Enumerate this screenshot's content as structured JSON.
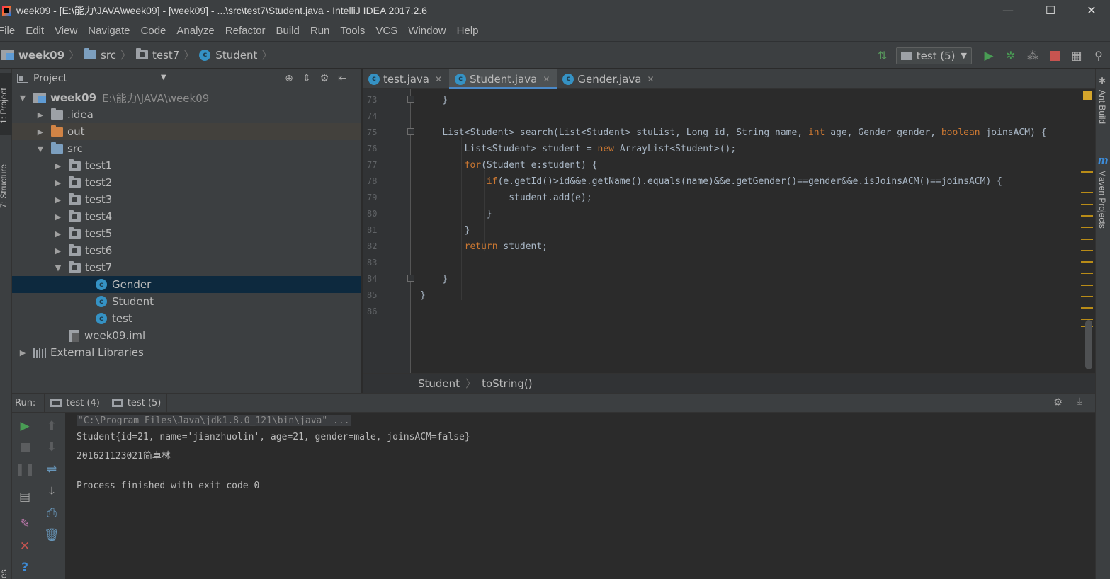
{
  "window": {
    "title": "week09 - [E:\\能力\\JAVA\\week09] - [week09] - ...\\src\\test7\\Student.java - IntelliJ IDEA 2017.2.6",
    "minimize": "—",
    "maximize": "☐",
    "close": "✕"
  },
  "menu": [
    {
      "rest": "ile",
      "mn": "F"
    },
    {
      "rest": "dit",
      "mn": "E"
    },
    {
      "rest": "iew",
      "mn": "V"
    },
    {
      "rest": "avigate",
      "mn": "N"
    },
    {
      "rest": "ode",
      "mn": "C"
    },
    {
      "rest": "nalyze",
      "mn": "A"
    },
    {
      "rest": "efactor",
      "mn": "R"
    },
    {
      "rest": "uild",
      "mn": "B"
    },
    {
      "rest": "un",
      "mn": "R"
    },
    {
      "rest": "ools",
      "mn": "T"
    },
    {
      "rest": "CS",
      "mn": "V"
    },
    {
      "rest": "indow",
      "mn": "W"
    },
    {
      "rest": "elp",
      "mn": "H"
    }
  ],
  "navbar": {
    "crumbs": [
      "week09",
      "src",
      "test7",
      "Student"
    ],
    "run_config": "test (5)"
  },
  "left_stripe": {
    "project_tab": "1: Project",
    "structure_tab": "7: Structure",
    "bottom_tab": "es"
  },
  "right_stripe": {
    "ant": "Ant Build",
    "maven": "Maven Projects"
  },
  "project_panel": {
    "title": "Project",
    "tree": [
      {
        "label": "week09",
        "hint": "E:\\能力\\JAVA\\week09",
        "icon": "module",
        "arrow": "▼",
        "depth": 0
      },
      {
        "label": ".idea",
        "icon": "folder-gray",
        "arrow": "▶",
        "depth": 1
      },
      {
        "label": "out",
        "icon": "folder-orange",
        "arrow": "▶",
        "depth": 1
      },
      {
        "label": "src",
        "icon": "folder-blue",
        "arrow": "▼",
        "depth": 1
      },
      {
        "label": "test1",
        "icon": "package",
        "arrow": "▶",
        "depth": 2
      },
      {
        "label": "test2",
        "icon": "package",
        "arrow": "▶",
        "depth": 2
      },
      {
        "label": "test3",
        "icon": "package",
        "arrow": "▶",
        "depth": 2
      },
      {
        "label": "test4",
        "icon": "package",
        "arrow": "▶",
        "depth": 2
      },
      {
        "label": "test5",
        "icon": "package",
        "arrow": "▶",
        "depth": 2
      },
      {
        "label": "test6",
        "icon": "package",
        "arrow": "▶",
        "depth": 2
      },
      {
        "label": "test7",
        "icon": "package",
        "arrow": "▼",
        "depth": 2
      },
      {
        "label": "Gender",
        "icon": "class",
        "arrow": "",
        "depth": 3,
        "selected": true
      },
      {
        "label": "Student",
        "icon": "class",
        "arrow": "",
        "depth": 3
      },
      {
        "label": "test",
        "icon": "class",
        "arrow": "",
        "depth": 3
      },
      {
        "label": "week09.iml",
        "icon": "iml",
        "arrow": "",
        "depth": 2
      },
      {
        "label": "External Libraries",
        "icon": "libs",
        "arrow": "▶",
        "depth": 0
      }
    ]
  },
  "editor": {
    "tabs": [
      {
        "label": "test.java",
        "active": false
      },
      {
        "label": "Student.java",
        "active": true
      },
      {
        "label": "Gender.java",
        "active": false
      }
    ],
    "line_numbers": [
      "73",
      "74",
      "75",
      "76",
      "77",
      "78",
      "79",
      "80",
      "81",
      "82",
      "83",
      "84",
      "85",
      "86"
    ],
    "code": [
      "    }",
      "",
      "    List<Student> search(List<Student> stuList, Long id, String name, int age, Gender gender, boolean joinsACM) {",
      "        List<Student> student = new ArrayList<Student>();",
      "        for(Student e:student) {",
      "            if(e.getId()>id&&e.getName().equals(name)&&e.getGender()==gender&&e.isJoinsACM()==joinsACM) {",
      "                student.add(e);",
      "            }",
      "        }",
      "        return student;",
      "",
      "    }",
      "}",
      ""
    ],
    "breadcrumb": [
      "Student",
      "toString()"
    ]
  },
  "run_panel": {
    "label": "Run:",
    "tabs": [
      "test (4)",
      "test (5)"
    ],
    "console": [
      "\"C:\\Program Files\\Java\\jdk1.8.0_121\\bin\\java\" ...",
      "Student{id=21, name='jianzhuolin', age=21, gender=male, joinsACM=false}",
      "201621123021简卓林",
      "",
      "Process finished with exit code 0"
    ]
  },
  "colors": {
    "accent": "#4a88c7",
    "keyword": "#cc7832",
    "run_green": "#499c54",
    "stop_red": "#c75450",
    "warning": "#b98c17"
  }
}
